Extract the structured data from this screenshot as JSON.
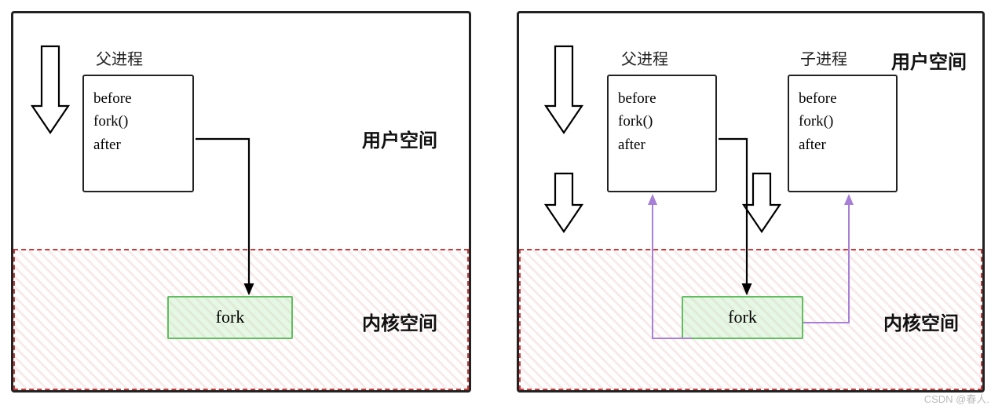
{
  "left": {
    "parent_label": "父进程",
    "code": {
      "l1": "before",
      "l2": "fork()",
      "l3": "after"
    },
    "user_space_label": "用户空间",
    "kernel_space_label": "内核空间",
    "fork_label": "fork"
  },
  "right": {
    "parent_label": "父进程",
    "child_label": "子进程",
    "parent_code": {
      "l1": "before",
      "l2": "fork()",
      "l3": "after"
    },
    "child_code": {
      "l1": "before",
      "l2": "fork()",
      "l3": "after"
    },
    "user_space_label": "用户空间",
    "kernel_space_label": "内核空间",
    "fork_label": "fork"
  },
  "watermark": "CSDN @春人."
}
